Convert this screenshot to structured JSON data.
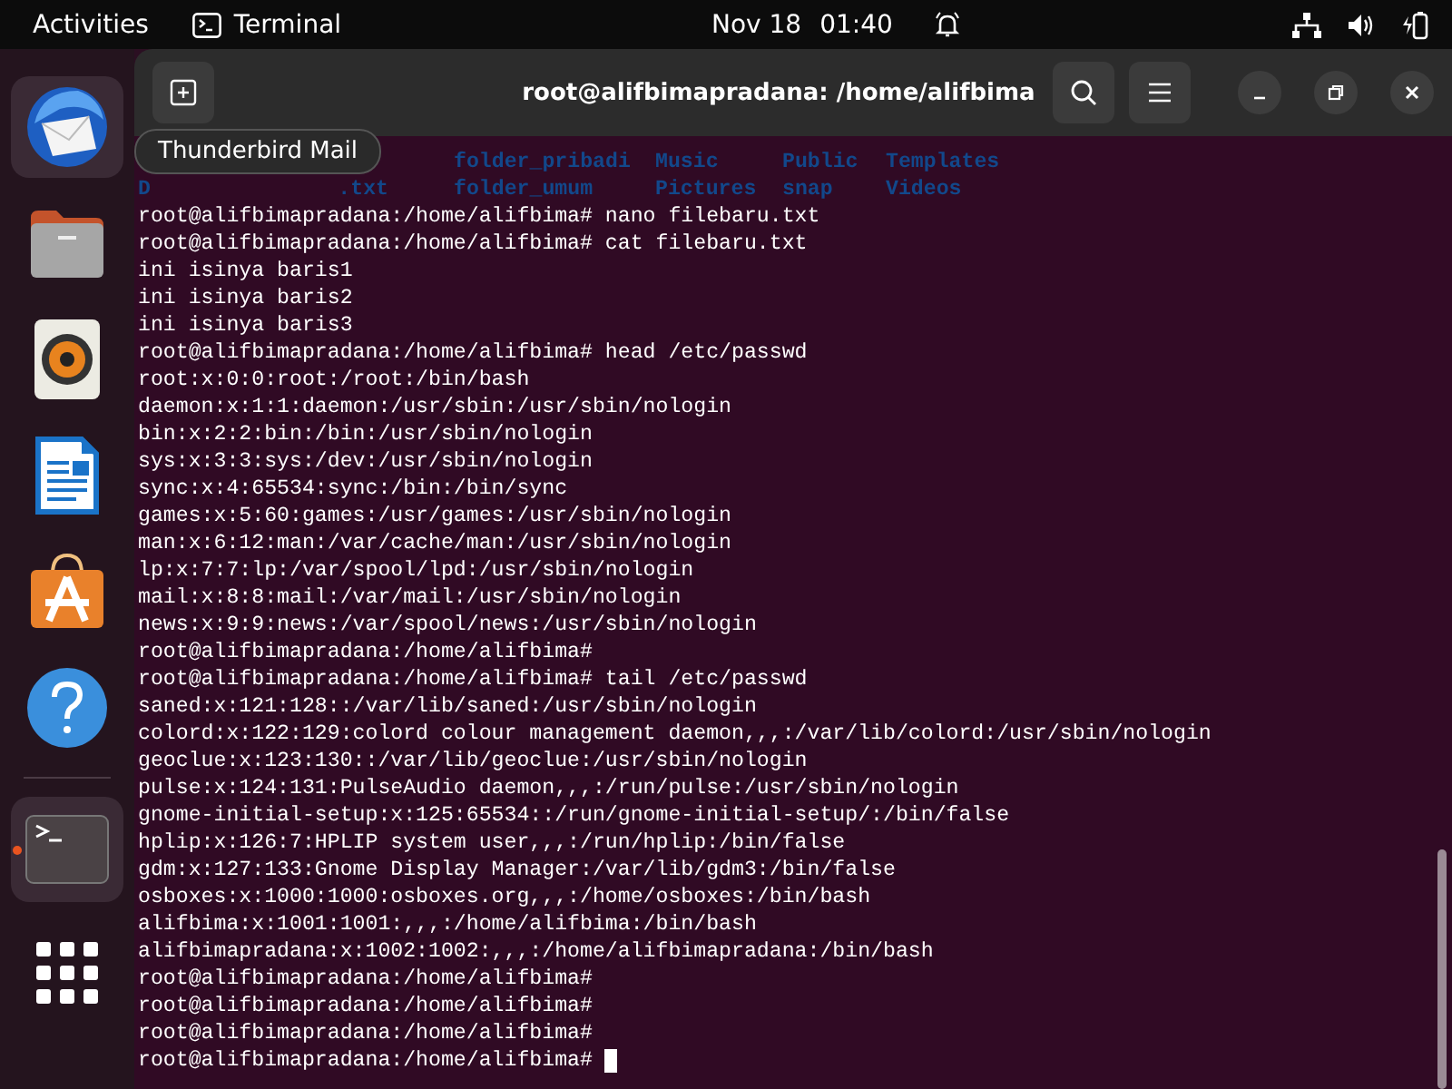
{
  "top_bar": {
    "activities": "Activities",
    "app_name": "Terminal",
    "date": "Nov 18",
    "time": "01:40"
  },
  "dock": {
    "items": [
      {
        "kind": "thunderbird",
        "running": false,
        "hovered": true
      },
      {
        "kind": "files",
        "running": false,
        "hovered": false
      },
      {
        "kind": "rhythmbox",
        "running": false,
        "hovered": false
      },
      {
        "kind": "writer",
        "running": false,
        "hovered": false
      },
      {
        "kind": "appcenter",
        "running": false,
        "hovered": false
      },
      {
        "kind": "help",
        "running": false,
        "hovered": false
      },
      {
        "kind": "terminal",
        "running": true,
        "hovered": false
      }
    ],
    "tooltip": "Thunderbird Mail"
  },
  "window": {
    "title": "root@alifbimapradana: /home/alifbima"
  },
  "ls_rows": [
    {
      "first": null,
      "cells": [
        "folder_pribadi",
        "Music",
        "Public",
        "Templates"
      ]
    },
    {
      "first": {
        "lead": "D",
        "tail": ".txt"
      },
      "cells": [
        "folder_umum",
        "Pictures",
        "snap",
        "Videos"
      ]
    }
  ],
  "lines": [
    "root@alifbimapradana:/home/alifbima# nano filebaru.txt",
    "root@alifbimapradana:/home/alifbima# cat filebaru.txt",
    "ini isinya baris1",
    "ini isinya baris2",
    "ini isinya baris3",
    "root@alifbimapradana:/home/alifbima# head /etc/passwd",
    "root:x:0:0:root:/root:/bin/bash",
    "daemon:x:1:1:daemon:/usr/sbin:/usr/sbin/nologin",
    "bin:x:2:2:bin:/bin:/usr/sbin/nologin",
    "sys:x:3:3:sys:/dev:/usr/sbin/nologin",
    "sync:x:4:65534:sync:/bin:/bin/sync",
    "games:x:5:60:games:/usr/games:/usr/sbin/nologin",
    "man:x:6:12:man:/var/cache/man:/usr/sbin/nologin",
    "lp:x:7:7:lp:/var/spool/lpd:/usr/sbin/nologin",
    "mail:x:8:8:mail:/var/mail:/usr/sbin/nologin",
    "news:x:9:9:news:/var/spool/news:/usr/sbin/nologin",
    "root@alifbimapradana:/home/alifbima#",
    "root@alifbimapradana:/home/alifbima# tail /etc/passwd",
    "saned:x:121:128::/var/lib/saned:/usr/sbin/nologin",
    "colord:x:122:129:colord colour management daemon,,,:/var/lib/colord:/usr/sbin/nologin",
    "geoclue:x:123:130::/var/lib/geoclue:/usr/sbin/nologin",
    "pulse:x:124:131:PulseAudio daemon,,,:/run/pulse:/usr/sbin/nologin",
    "gnome-initial-setup:x:125:65534::/run/gnome-initial-setup/:/bin/false",
    "hplip:x:126:7:HPLIP system user,,,:/run/hplip:/bin/false",
    "gdm:x:127:133:Gnome Display Manager:/var/lib/gdm3:/bin/false",
    "osboxes:x:1000:1000:osboxes.org,,,:/home/osboxes:/bin/bash",
    "alifbima:x:1001:1001:,,,:/home/alifbima:/bin/bash",
    "alifbimapradana:x:1002:1002:,,,:/home/alifbimapradana:/bin/bash",
    "root@alifbimapradana:/home/alifbima#",
    "root@alifbimapradana:/home/alifbima#",
    "root@alifbimapradana:/home/alifbima#",
    "root@alifbimapradana:/home/alifbima#"
  ],
  "cursor_visible": true
}
